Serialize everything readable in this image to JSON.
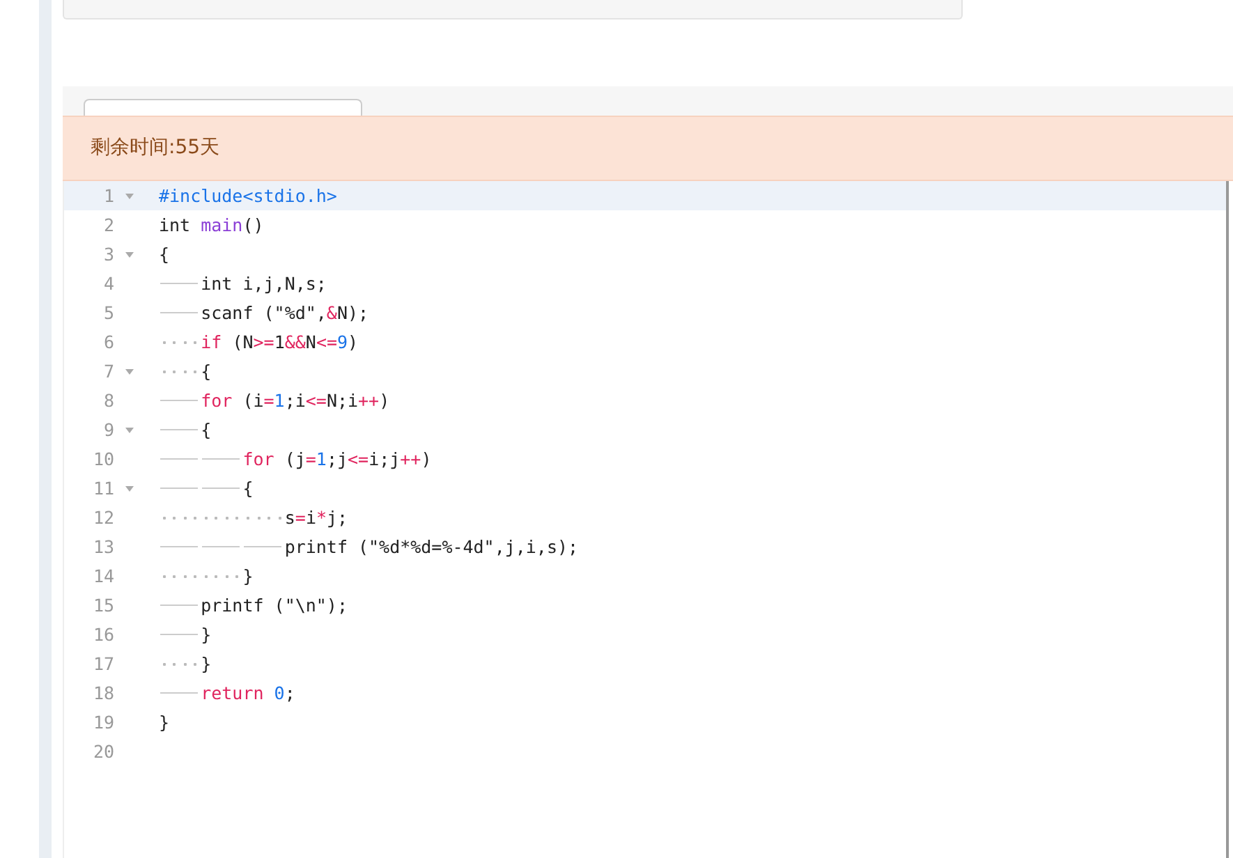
{
  "alert": {
    "text": "剩余时间:55天"
  },
  "editor": {
    "lines": [
      {
        "number": "1",
        "foldable": true,
        "active": true,
        "tokens": [
          {
            "kind": "directive",
            "text": "#include<stdio.h>"
          }
        ]
      },
      {
        "number": "2",
        "foldable": false,
        "active": false,
        "tokens": [
          {
            "kind": "plain",
            "text": "int "
          },
          {
            "kind": "function",
            "text": "main"
          },
          {
            "kind": "plain",
            "text": "()"
          }
        ]
      },
      {
        "number": "3",
        "foldable": true,
        "active": false,
        "tokens": [
          {
            "kind": "plain",
            "text": "{"
          }
        ]
      },
      {
        "number": "4",
        "foldable": false,
        "active": false,
        "tokens": [
          {
            "kind": "plain",
            "text": "\tint i,j,N,s;"
          }
        ]
      },
      {
        "number": "5",
        "foldable": false,
        "active": false,
        "tokens": [
          {
            "kind": "plain",
            "text": "\tscanf (\"%d\","
          },
          {
            "kind": "operator",
            "text": "&"
          },
          {
            "kind": "plain",
            "text": "N);"
          }
        ]
      },
      {
        "number": "6",
        "foldable": false,
        "active": false,
        "tokens": [
          {
            "kind": "keyword",
            "text": "    if"
          },
          {
            "kind": "plain",
            "text": " (N"
          },
          {
            "kind": "operator",
            "text": ">="
          },
          {
            "kind": "plain",
            "text": "1"
          },
          {
            "kind": "operator",
            "text": "&&"
          },
          {
            "kind": "plain",
            "text": "N"
          },
          {
            "kind": "operator",
            "text": "<="
          },
          {
            "kind": "number",
            "text": "9"
          },
          {
            "kind": "plain",
            "text": ")"
          }
        ]
      },
      {
        "number": "7",
        "foldable": true,
        "active": false,
        "tokens": [
          {
            "kind": "plain",
            "text": "    {"
          }
        ]
      },
      {
        "number": "8",
        "foldable": false,
        "active": false,
        "tokens": [
          {
            "kind": "keyword",
            "text": "\tfor"
          },
          {
            "kind": "plain",
            "text": " (i"
          },
          {
            "kind": "operator",
            "text": "="
          },
          {
            "kind": "number",
            "text": "1"
          },
          {
            "kind": "plain",
            "text": ";i"
          },
          {
            "kind": "operator",
            "text": "<="
          },
          {
            "kind": "plain",
            "text": "N;i"
          },
          {
            "kind": "operator",
            "text": "++"
          },
          {
            "kind": "plain",
            "text": ")"
          }
        ]
      },
      {
        "number": "9",
        "foldable": true,
        "active": false,
        "tokens": [
          {
            "kind": "plain",
            "text": "\t{"
          }
        ]
      },
      {
        "number": "10",
        "foldable": false,
        "active": false,
        "tokens": [
          {
            "kind": "keyword",
            "text": "\t\tfor"
          },
          {
            "kind": "plain",
            "text": " (j"
          },
          {
            "kind": "operator",
            "text": "="
          },
          {
            "kind": "number",
            "text": "1"
          },
          {
            "kind": "plain",
            "text": ";j"
          },
          {
            "kind": "operator",
            "text": "<="
          },
          {
            "kind": "plain",
            "text": "i;j"
          },
          {
            "kind": "operator",
            "text": "++"
          },
          {
            "kind": "plain",
            "text": ")"
          }
        ]
      },
      {
        "number": "11",
        "foldable": true,
        "active": false,
        "tokens": [
          {
            "kind": "plain",
            "text": "\t\t{"
          }
        ]
      },
      {
        "number": "12",
        "foldable": false,
        "active": false,
        "tokens": [
          {
            "kind": "plain",
            "text": "            s"
          },
          {
            "kind": "operator",
            "text": "="
          },
          {
            "kind": "plain",
            "text": "i"
          },
          {
            "kind": "operator",
            "text": "*"
          },
          {
            "kind": "plain",
            "text": "j;"
          }
        ]
      },
      {
        "number": "13",
        "foldable": false,
        "active": false,
        "tokens": [
          {
            "kind": "plain",
            "text": "\t\t\tprintf (\"%d*%d=%-4d\",j,i,s);"
          }
        ]
      },
      {
        "number": "14",
        "foldable": false,
        "active": false,
        "tokens": [
          {
            "kind": "plain",
            "text": "        }"
          }
        ]
      },
      {
        "number": "15",
        "foldable": false,
        "active": false,
        "tokens": [
          {
            "kind": "plain",
            "text": "\tprintf (\"\\n\");"
          }
        ]
      },
      {
        "number": "16",
        "foldable": false,
        "active": false,
        "tokens": [
          {
            "kind": "plain",
            "text": "\t}"
          }
        ]
      },
      {
        "number": "17",
        "foldable": false,
        "active": false,
        "tokens": [
          {
            "kind": "plain",
            "text": "    }"
          }
        ]
      },
      {
        "number": "18",
        "foldable": false,
        "active": false,
        "tokens": [
          {
            "kind": "keyword",
            "text": "\treturn"
          },
          {
            "kind": "number",
            "text": " 0"
          },
          {
            "kind": "plain",
            "text": ";"
          }
        ]
      },
      {
        "number": "19",
        "foldable": false,
        "active": false,
        "tokens": [
          {
            "kind": "plain",
            "text": "}"
          }
        ]
      },
      {
        "number": "20",
        "foldable": false,
        "active": false
      }
    ]
  }
}
